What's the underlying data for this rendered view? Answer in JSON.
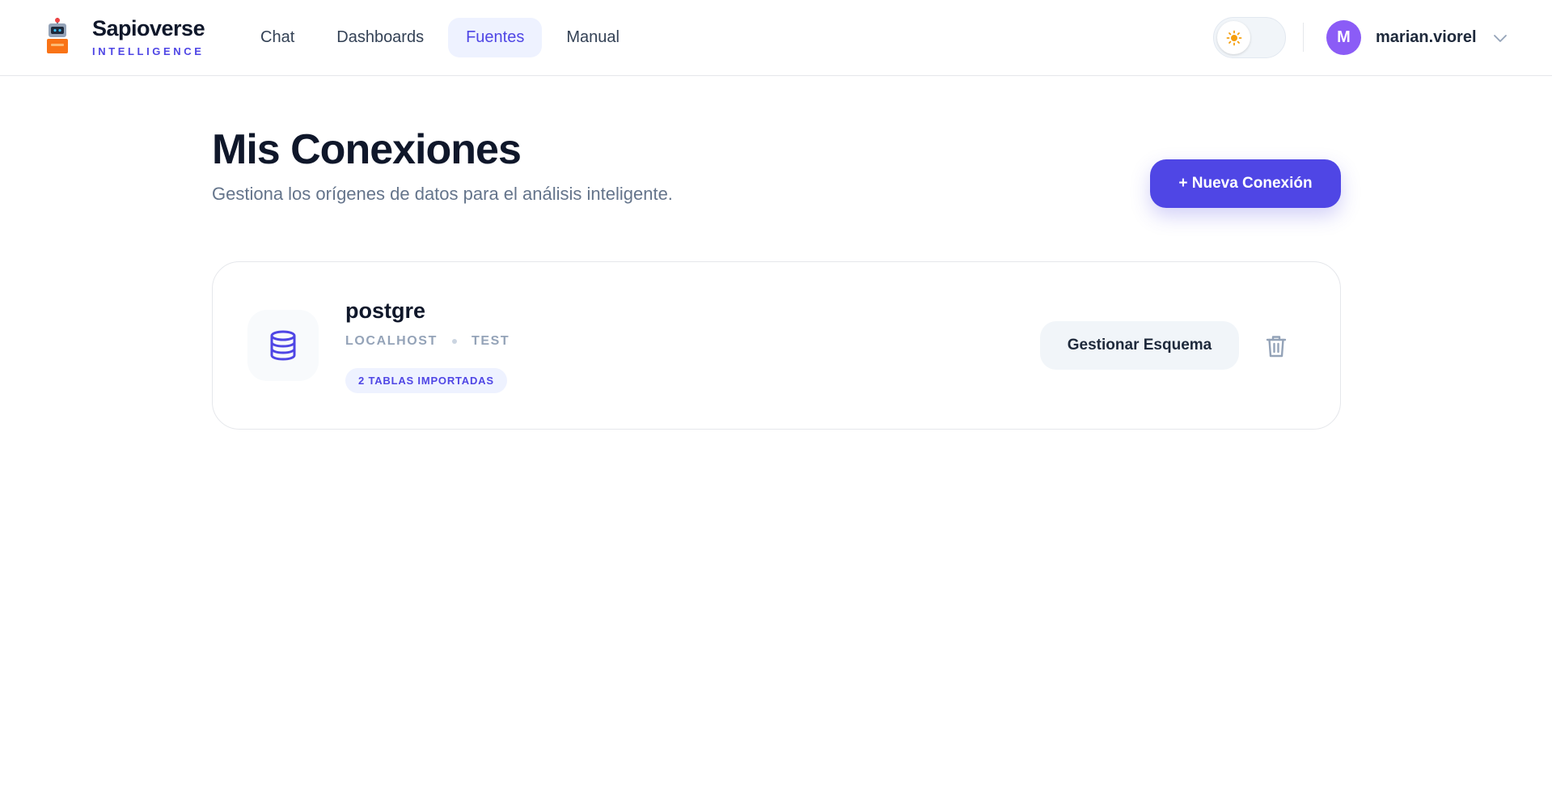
{
  "brand": {
    "name": "Sapioverse",
    "tagline": "INTELLIGENCE",
    "logo_icon": "robot-icon"
  },
  "nav": {
    "items": [
      {
        "label": "Chat",
        "active": false
      },
      {
        "label": "Dashboards",
        "active": false
      },
      {
        "label": "Fuentes",
        "active": true
      },
      {
        "label": "Manual",
        "active": false
      }
    ]
  },
  "theme_toggle": {
    "icon": "sun-icon",
    "mode": "light"
  },
  "user": {
    "initial": "M",
    "name": "marian.viorel",
    "menu_icon": "chevron-down-icon"
  },
  "page": {
    "title": "Mis Conexiones",
    "subtitle": "Gestiona los orígenes de datos para el análisis inteligente.",
    "new_button": "+ Nueva Conexión"
  },
  "connections": [
    {
      "name": "postgre",
      "host": "LOCALHOST",
      "database": "TEST",
      "badge": "2 TABLAS IMPORTADAS",
      "icon": "database-icon",
      "manage_label": "Gestionar Esquema",
      "delete_icon": "trash-icon"
    }
  ],
  "colors": {
    "accent": "#4f46e5",
    "avatar": "#8b5cf6",
    "text": "#0f172a",
    "muted": "#64748b"
  }
}
